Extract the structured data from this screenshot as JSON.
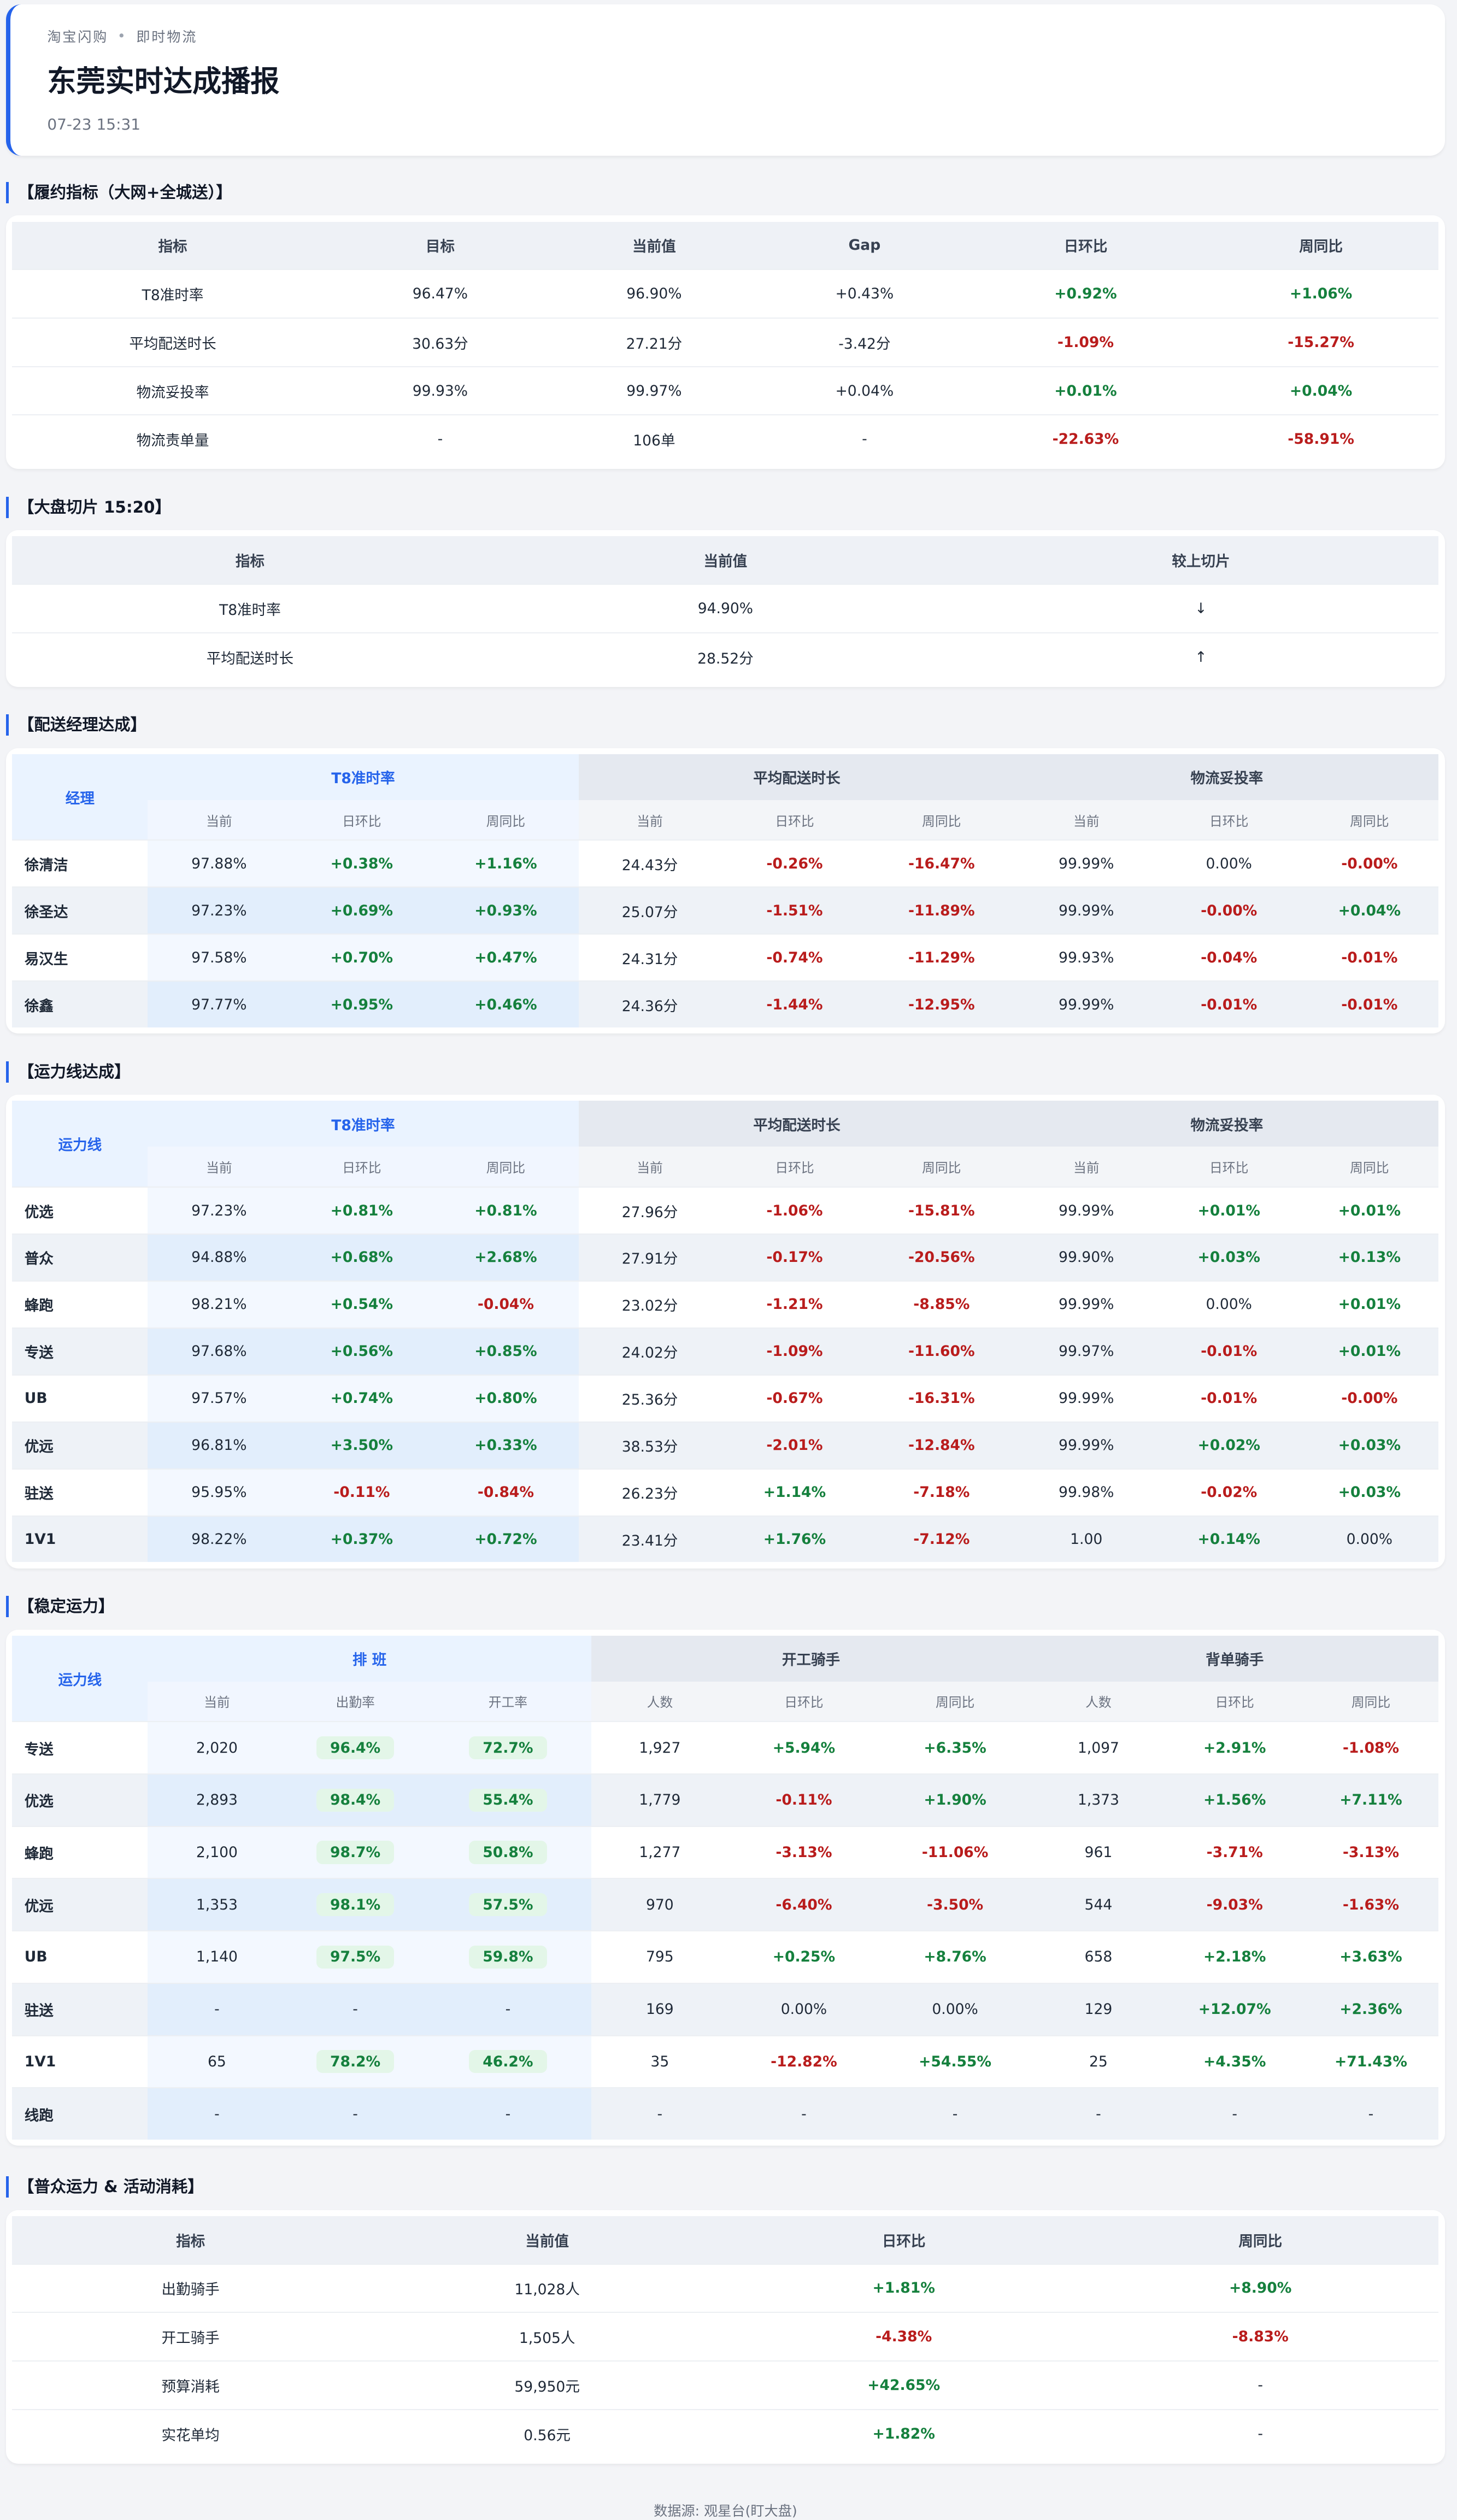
{
  "header": {
    "breadcrumb": [
      "淘宝闪购",
      "即时物流"
    ],
    "title": "东莞实时达成播报",
    "time": "07-23 15:31"
  },
  "sections": {
    "fulfillment": "【履约指标（大网+全城送）】",
    "snapshot": "【大盘切片 15:20】",
    "manager": "【配送经理达成】",
    "capacity": "【运力线达成】",
    "stable": "【稳定运力】",
    "puzhong": "【普众运力 & 活动消耗】"
  },
  "fulfillment": {
    "headers": [
      "指标",
      "目标",
      "当前值",
      "Gap",
      "日环比",
      "周同比"
    ],
    "rows": [
      [
        "T8准时率",
        "96.47%",
        "96.90%",
        "+0.43%",
        "+0.92%",
        "+1.06%"
      ],
      [
        "平均配送时长",
        "30.63分",
        "27.21分",
        "-3.42分",
        "-1.09%",
        "-15.27%"
      ],
      [
        "物流妥投率",
        "99.93%",
        "99.97%",
        "+0.04%",
        "+0.01%",
        "+0.04%"
      ],
      [
        "物流责单量",
        "-",
        "106单",
        "-",
        "-22.63%",
        "-58.91%"
      ]
    ]
  },
  "snapshot": {
    "headers": [
      "指标",
      "当前值",
      "较上切片"
    ],
    "rows": [
      [
        "T8准时率",
        "94.90%",
        "↓"
      ],
      [
        "平均配送时长",
        "28.52分",
        "↑"
      ]
    ]
  },
  "manager": {
    "corner": "经理",
    "groups": [
      "T8准时率",
      "平均配送时长",
      "物流妥投率"
    ],
    "subs": [
      "当前",
      "日环比",
      "周同比",
      "当前",
      "日环比",
      "周同比",
      "当前",
      "日环比",
      "周同比"
    ],
    "rows": [
      [
        "徐清洁",
        "97.88%",
        "+0.38%",
        "+1.16%",
        "24.43分",
        "-0.26%",
        "-16.47%",
        "99.99%",
        "0.00%",
        "-0.00%"
      ],
      [
        "徐圣达",
        "97.23%",
        "+0.69%",
        "+0.93%",
        "25.07分",
        "-1.51%",
        "-11.89%",
        "99.99%",
        "-0.00%",
        "+0.04%"
      ],
      [
        "易汉生",
        "97.58%",
        "+0.70%",
        "+0.47%",
        "24.31分",
        "-0.74%",
        "-11.29%",
        "99.93%",
        "-0.04%",
        "-0.01%"
      ],
      [
        "徐鑫",
        "97.77%",
        "+0.95%",
        "+0.46%",
        "24.36分",
        "-1.44%",
        "-12.95%",
        "99.99%",
        "-0.01%",
        "-0.01%"
      ]
    ]
  },
  "capacity": {
    "corner": "运力线",
    "groups": [
      "T8准时率",
      "平均配送时长",
      "物流妥投率"
    ],
    "subs": [
      "当前",
      "日环比",
      "周同比",
      "当前",
      "日环比",
      "周同比",
      "当前",
      "日环比",
      "周同比"
    ],
    "rows": [
      [
        "优选",
        "97.23%",
        "+0.81%",
        "+0.81%",
        "27.96分",
        "-1.06%",
        "-15.81%",
        "99.99%",
        "+0.01%",
        "+0.01%"
      ],
      [
        "普众",
        "94.88%",
        "+0.68%",
        "+2.68%",
        "27.91分",
        "-0.17%",
        "-20.56%",
        "99.90%",
        "+0.03%",
        "+0.13%"
      ],
      [
        "蜂跑",
        "98.21%",
        "+0.54%",
        "-0.04%",
        "23.02分",
        "-1.21%",
        "-8.85%",
        "99.99%",
        "0.00%",
        "+0.01%"
      ],
      [
        "专送",
        "97.68%",
        "+0.56%",
        "+0.85%",
        "24.02分",
        "-1.09%",
        "-11.60%",
        "99.97%",
        "-0.01%",
        "+0.01%"
      ],
      [
        "UB",
        "97.57%",
        "+0.74%",
        "+0.80%",
        "25.36分",
        "-0.67%",
        "-16.31%",
        "99.99%",
        "-0.01%",
        "-0.00%"
      ],
      [
        "优远",
        "96.81%",
        "+3.50%",
        "+0.33%",
        "38.53分",
        "-2.01%",
        "-12.84%",
        "99.99%",
        "+0.02%",
        "+0.03%"
      ],
      [
        "驻送",
        "95.95%",
        "-0.11%",
        "-0.84%",
        "26.23分",
        "+1.14%",
        "-7.18%",
        "99.98%",
        "-0.02%",
        "+0.03%"
      ],
      [
        "1V1",
        "98.22%",
        "+0.37%",
        "+0.72%",
        "23.41分",
        "+1.76%",
        "-7.12%",
        "1.00",
        "+0.14%",
        "0.00%"
      ]
    ]
  },
  "stable": {
    "corner": "运力线",
    "groups": [
      "排 班",
      "开工骑手",
      "背单骑手"
    ],
    "subs": [
      "当前",
      "出勤率",
      "开工率",
      "人数",
      "日环比",
      "周同比",
      "人数",
      "日环比",
      "周同比"
    ],
    "rows": [
      [
        "专送",
        "2,020",
        "96.4%",
        "72.7%",
        "1,927",
        "+5.94%",
        "+6.35%",
        "1,097",
        "+2.91%",
        "-1.08%"
      ],
      [
        "优选",
        "2,893",
        "98.4%",
        "55.4%",
        "1,779",
        "-0.11%",
        "+1.90%",
        "1,373",
        "+1.56%",
        "+7.11%"
      ],
      [
        "蜂跑",
        "2,100",
        "98.7%",
        "50.8%",
        "1,277",
        "-3.13%",
        "-11.06%",
        "961",
        "-3.71%",
        "-3.13%"
      ],
      [
        "优远",
        "1,353",
        "98.1%",
        "57.5%",
        "970",
        "-6.40%",
        "-3.50%",
        "544",
        "-9.03%",
        "-1.63%"
      ],
      [
        "UB",
        "1,140",
        "97.5%",
        "59.8%",
        "795",
        "+0.25%",
        "+8.76%",
        "658",
        "+2.18%",
        "+3.63%"
      ],
      [
        "驻送",
        "-",
        "-",
        "-",
        "169",
        "0.00%",
        "0.00%",
        "129",
        "+12.07%",
        "+2.36%"
      ],
      [
        "1V1",
        "65",
        "78.2%",
        "46.2%",
        "35",
        "-12.82%",
        "+54.55%",
        "25",
        "+4.35%",
        "+71.43%"
      ],
      [
        "线跑",
        "-",
        "-",
        "-",
        "-",
        "-",
        "-",
        "-",
        "-",
        "-"
      ]
    ]
  },
  "puzhong": {
    "headers": [
      "指标",
      "当前值",
      "日环比",
      "周同比"
    ],
    "rows": [
      [
        "出勤骑手",
        "11,028人",
        "+1.81%",
        "+8.90%"
      ],
      [
        "开工骑手",
        "1,505人",
        "-4.38%",
        "-8.83%"
      ],
      [
        "预算消耗",
        "59,950元",
        "+42.65%",
        "-"
      ],
      [
        "实花单均",
        "0.56元",
        "+1.82%",
        "-"
      ]
    ]
  },
  "footer": "数据源: 观星台(盯大盘)",
  "colors": {
    "accent": "#2563eb",
    "positive": "#15803d",
    "negative": "#b91c1c"
  }
}
